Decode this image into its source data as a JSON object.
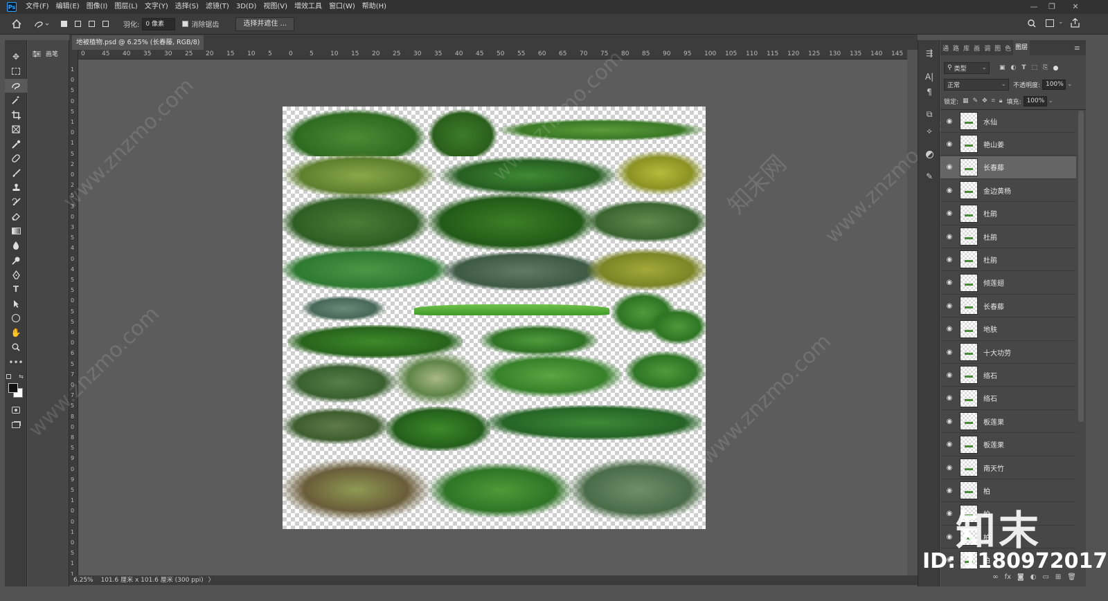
{
  "app": {
    "logo": "Ps"
  },
  "menu": [
    "文件(F)",
    "编辑(E)",
    "图像(I)",
    "图层(L)",
    "文字(Y)",
    "选择(S)",
    "滤镜(T)",
    "3D(D)",
    "视图(V)",
    "增效工具",
    "窗口(W)",
    "帮助(H)"
  ],
  "options": {
    "feather_label": "羽化:",
    "feather_value": "0 像素",
    "antialias_label": "消除锯齿",
    "select_mask_label": "选择并遮住 ..."
  },
  "brush_panel": {
    "label": "画笔"
  },
  "document": {
    "tab_title": "地被植物.psd @ 6.25% (长春藤, RGB/8)",
    "close_glyph": "×"
  },
  "ruler": {
    "h_ticks": [
      "0",
      "45",
      "40",
      "35",
      "30",
      "25",
      "20",
      "15",
      "10",
      "5",
      "0",
      "5",
      "10",
      "15",
      "20",
      "25",
      "30",
      "35",
      "40",
      "45",
      "50",
      "55",
      "60",
      "65",
      "70",
      "75",
      "80",
      "85",
      "90",
      "95",
      "100",
      "105",
      "110",
      "115",
      "120",
      "125",
      "130",
      "135",
      "140",
      "145"
    ],
    "v_ticks": [
      "1",
      "0",
      "5",
      "0",
      "5",
      "1",
      "0",
      "1",
      "5",
      "2",
      "0",
      "2",
      "5",
      "3",
      "0",
      "3",
      "5",
      "4",
      "0",
      "4",
      "5",
      "5",
      "0",
      "5",
      "5",
      "6",
      "0",
      "6",
      "5",
      "7",
      "0",
      "7",
      "5",
      "8",
      "0",
      "8",
      "5",
      "9",
      "0",
      "9",
      "5",
      "1",
      "0",
      "0",
      "1",
      "0",
      "5",
      "1",
      "1"
    ]
  },
  "status": {
    "zoom": "6.25%",
    "dimensions": "101.6 厘米 x 101.6 厘米 (300 ppi)",
    "arrow": "〉"
  },
  "layers_panel": {
    "tabs": [
      "通",
      "路",
      "库",
      "画",
      "调",
      "图",
      "色",
      "图层"
    ],
    "active_tab": "图层",
    "filter_label": "类型",
    "blend_mode": "正常",
    "opacity_label": "不透明度:",
    "opacity_value": "100%",
    "lock_label": "锁定:",
    "fill_label": "填充:",
    "fill_value": "100%",
    "layers": [
      "水仙",
      "艳山姜",
      "长春藤",
      "金边黄杨",
      "杜鹃",
      "杜鹃",
      "杜鹃",
      "倾莲翅",
      "长春藤",
      "地肤",
      "十大功劳",
      "络石",
      "络石",
      "板莲果",
      "板莲果",
      "南天竹",
      "柏",
      "柏",
      "柏",
      "柏"
    ],
    "selected_index": 2
  },
  "watermarks": [
    "www.znzmo.com",
    "知末网"
  ],
  "brand_logo": {
    "text": "知末",
    "id": "ID: 1180972017"
  },
  "colors": {
    "accent_ps": "#31a8ff",
    "panel_dark": "#323232",
    "panel": "#3c3c3c",
    "canvas": "#5c5c5c"
  }
}
